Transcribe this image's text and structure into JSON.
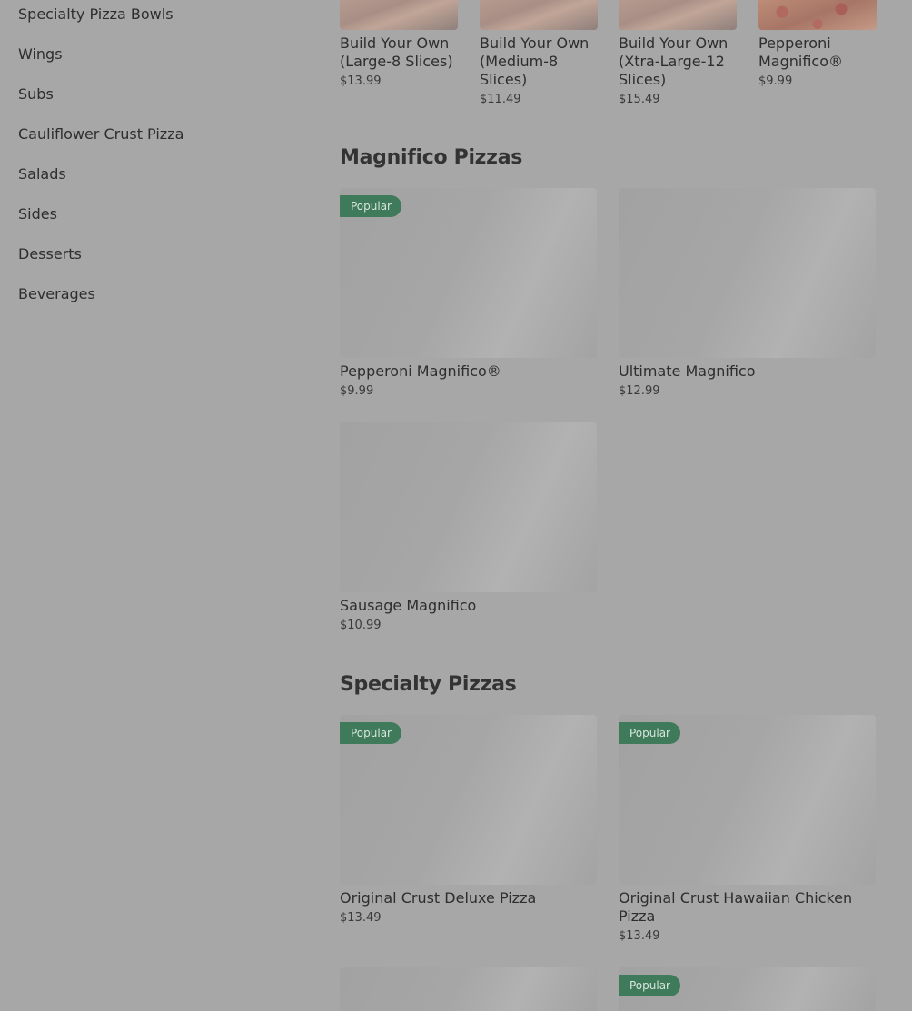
{
  "sidebar": {
    "items": [
      {
        "label": "Specialty Pizza Bowls"
      },
      {
        "label": "Wings"
      },
      {
        "label": "Subs"
      },
      {
        "label": "Cauliflower Crust Pizza"
      },
      {
        "label": "Salads"
      },
      {
        "label": "Sides"
      },
      {
        "label": "Desserts"
      },
      {
        "label": "Beverages"
      }
    ]
  },
  "top_row": {
    "items": [
      {
        "title": "Build Your Own (Large-8 Slices)",
        "price": "$13.99"
      },
      {
        "title": "Build Your Own (Medium-8 Slices)",
        "price": "$11.49"
      },
      {
        "title": "Build Your Own (Xtra-Large-12 Slices)",
        "price": "$15.49"
      },
      {
        "title": "Pepperoni Magnifico®",
        "price": "$9.99"
      }
    ]
  },
  "sections": [
    {
      "title": "Magnifico Pizzas",
      "items": [
        {
          "title": "Pepperoni Magnifico®",
          "price": "$9.99",
          "badge": "Popular"
        },
        {
          "title": "Ultimate Magnifico",
          "price": "$12.99"
        },
        {
          "title": "Sausage Magnifico",
          "price": "$10.99"
        }
      ]
    },
    {
      "title": "Specialty Pizzas",
      "items": [
        {
          "title": "Original Crust Deluxe Pizza",
          "price": "$13.49",
          "badge": "Popular"
        },
        {
          "title": "Original Crust Hawaiian Chicken Pizza",
          "price": "$13.49",
          "badge": "Popular"
        },
        {
          "title": "",
          "price": ""
        },
        {
          "title": "",
          "price": "",
          "badge": "Popular"
        }
      ]
    }
  ],
  "colors": {
    "overlay_background": "#a7a7a7",
    "badge_background": "#3f7a5a",
    "text": "#2e2e2e"
  }
}
